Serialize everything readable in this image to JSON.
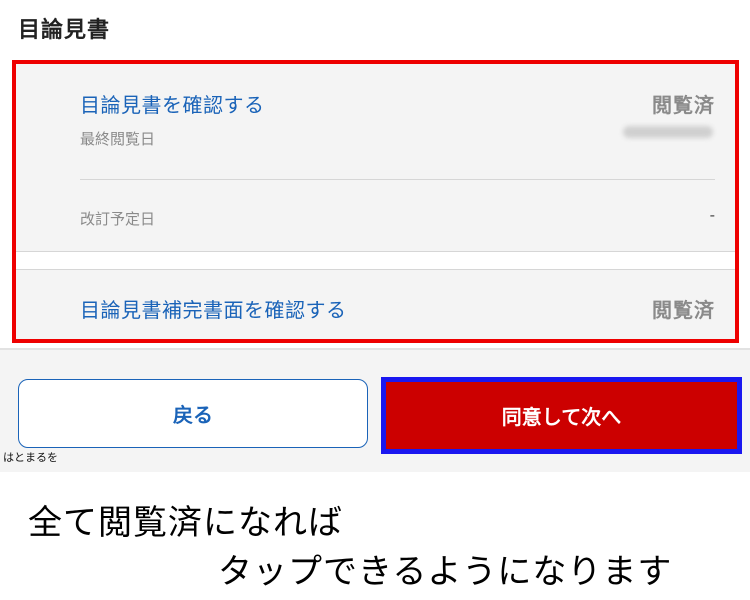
{
  "header": {
    "title": "目論見書"
  },
  "documents": {
    "item1": {
      "link_label": "目論見書を確認する",
      "status": "閲覧済",
      "last_viewed_label": "最終閲覧日",
      "revision_label": "改訂予定日",
      "revision_value": "-"
    },
    "item2": {
      "link_label": "目論見書補完書面を確認する",
      "status": "閲覧済"
    }
  },
  "actions": {
    "back_label": "戻る",
    "next_label": "同意して次へ"
  },
  "watermark": "はとまるを",
  "caption": {
    "line1": "全て閲覧済になれば",
    "line2": "タップできるようになります"
  },
  "colors": {
    "accent_link": "#1a63b8",
    "highlight_box": "#ee0000",
    "highlight_button": "#1a17f0",
    "primary_button": "#cc0000"
  }
}
